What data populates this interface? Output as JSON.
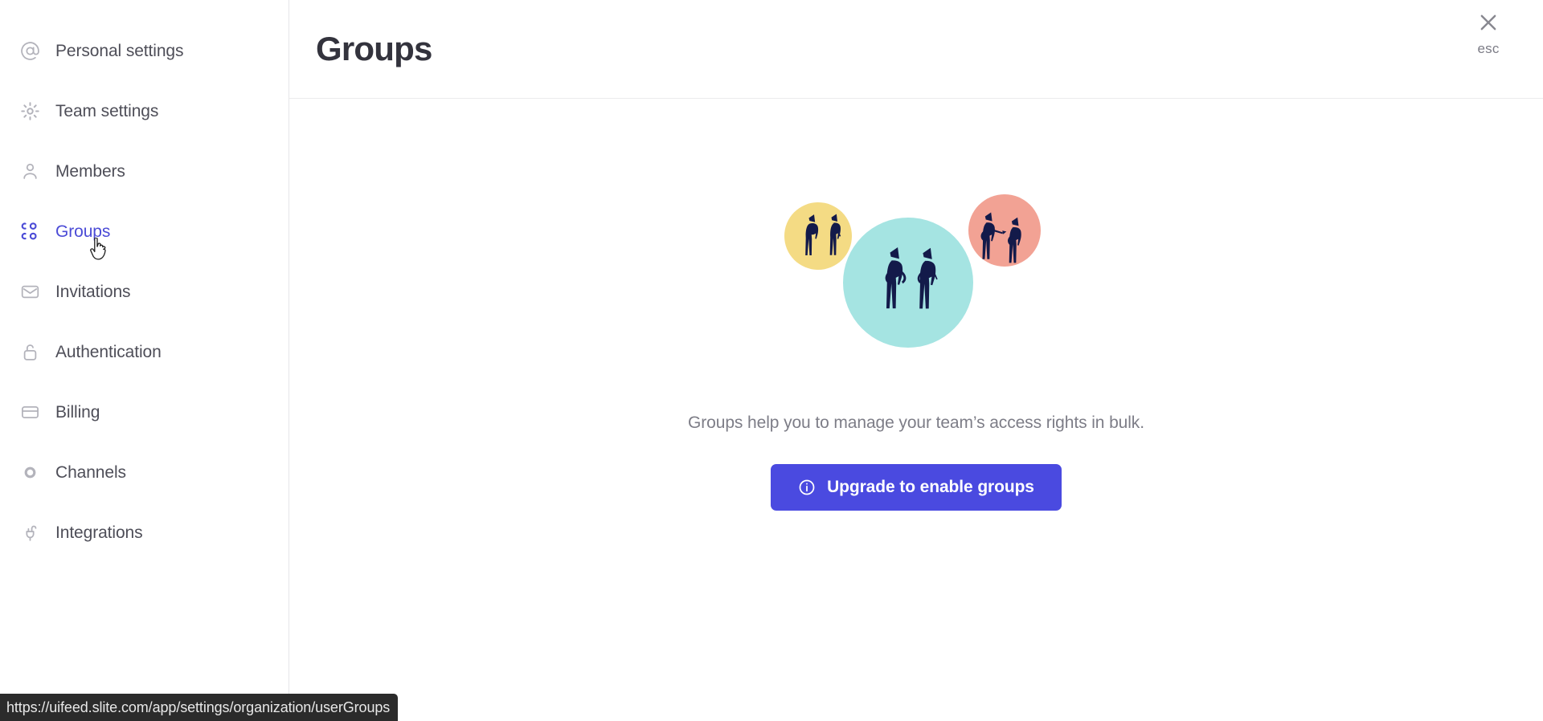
{
  "window": {
    "status_bar_url": "https://uifeed.slite.com/app/settings/organization/userGroups"
  },
  "sidebar": {
    "items": [
      {
        "id": "personal-settings",
        "label": "Personal settings",
        "icon": "at-sign-icon",
        "active": false
      },
      {
        "id": "team-settings",
        "label": "Team settings",
        "icon": "gear-icon",
        "active": false
      },
      {
        "id": "members",
        "label": "Members",
        "icon": "user-icon",
        "active": false
      },
      {
        "id": "groups",
        "label": "Groups",
        "icon": "users-group-icon",
        "active": true
      },
      {
        "id": "invitations",
        "label": "Invitations",
        "icon": "envelope-icon",
        "active": false
      },
      {
        "id": "authentication",
        "label": "Authentication",
        "icon": "unlocked-padlock-icon",
        "active": false
      },
      {
        "id": "billing",
        "label": "Billing",
        "icon": "credit-card-icon",
        "active": false
      },
      {
        "id": "channels",
        "label": "Channels",
        "icon": "circle-icon",
        "active": false
      },
      {
        "id": "integrations",
        "label": "Integrations",
        "icon": "plug-icon",
        "active": false
      }
    ]
  },
  "header": {
    "title": "Groups",
    "close_icon": "close-x-icon",
    "close_label": "esc"
  },
  "main": {
    "description": "Groups help you to manage your team’s access rights in bulk.",
    "upgrade_button": {
      "label": "Upgrade to enable groups",
      "icon": "info-circle-icon"
    },
    "illustration": {
      "name": "groups-people-illustration",
      "circles": [
        {
          "id": "yellow-circle",
          "color": "#F4DB84",
          "people": 2
        },
        {
          "id": "teal-circle",
          "color": "#A5E4E2",
          "people": 2
        },
        {
          "id": "salmon-circle",
          "color": "#F2A294",
          "people": 2
        }
      ],
      "figure_color": "#131a4a"
    }
  },
  "colors": {
    "accent": "#4a4ae0",
    "active_nav": "#4b4bd6",
    "nav_text": "#4e4e58",
    "nav_icon": "#b3b3bb",
    "title": "#33333d",
    "muted_text": "#7d7d87",
    "border": "#e6e6e8",
    "status_bar_bg": "#2b2b2b"
  }
}
